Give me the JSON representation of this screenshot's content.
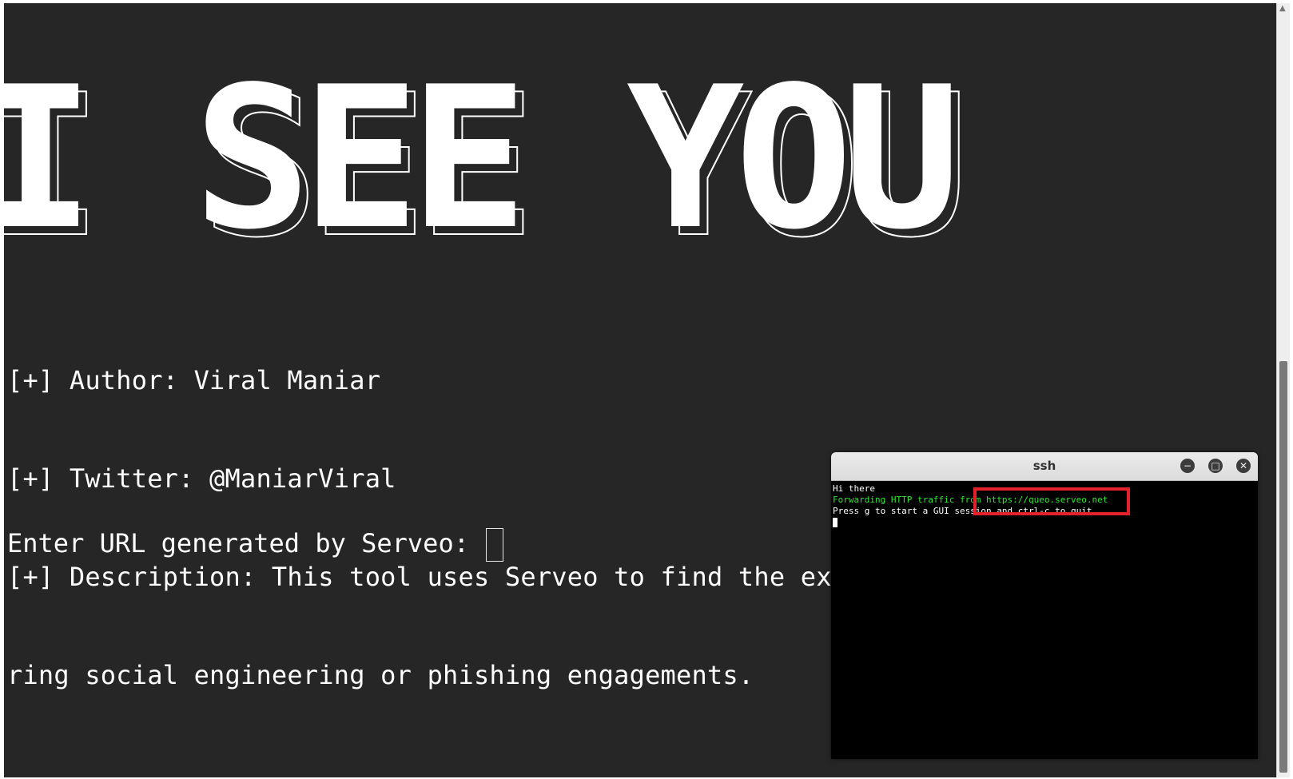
{
  "banner": {
    "text": "I SEE YOU"
  },
  "info": {
    "author": "[+] Author: Viral Maniar",
    "twitter": "[+] Twitter: @ManiarViral",
    "description_line1": "[+] Description: This tool uses Serveo to find the exact location of the user du",
    "description_line2": "ring social engineering or phishing engagements."
  },
  "prompt": {
    "label": "Enter URL generated by Serveo: "
  },
  "ssh_window": {
    "title": "ssh",
    "lines": {
      "line1": "Hi there",
      "line2": "Forwarding HTTP traffic from https://queo.serveo.net",
      "line3": "Press g to start a GUI session and ctrl-c to quit"
    },
    "buttons": {
      "minimize": "−",
      "maximize": "□",
      "close": "✕"
    }
  },
  "colors": {
    "terminal_bg": "#262626",
    "terminal_text": "#ffffff",
    "ssh_bg": "#000000",
    "ssh_green": "#2ee82e",
    "highlight": "#e3212b"
  }
}
